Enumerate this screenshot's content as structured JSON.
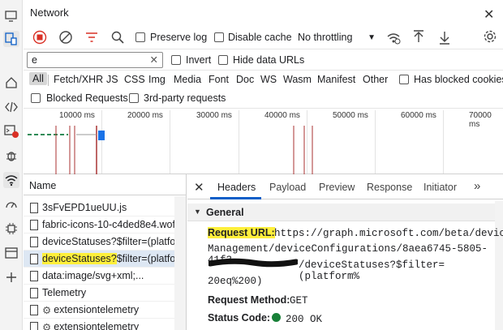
{
  "panel": {
    "title": "Network"
  },
  "toolbar": {
    "preserve_log": "Preserve log",
    "disable_cache": "Disable cache",
    "throttling": "No throttling"
  },
  "filter": {
    "value": "e",
    "invert": "Invert",
    "hide_data_urls": "Hide data URLs"
  },
  "types": [
    "All",
    "Fetch/XHR",
    "JS",
    "CSS",
    "Img",
    "Media",
    "Font",
    "Doc",
    "WS",
    "Wasm",
    "Manifest",
    "Other"
  ],
  "has_blocked_cookies": "Has blocked cookies",
  "blocked_requests": "Blocked Requests",
  "third_party": "3rd-party requests",
  "timeline": {
    "ticks": [
      "10000 ms",
      "20000 ms",
      "30000 ms",
      "40000 ms",
      "50000 ms",
      "60000 ms",
      "70000 ms"
    ]
  },
  "table": {
    "name_header": "Name",
    "rows": [
      {
        "name": "3sFvEPD1ueUU.js",
        "gear": false
      },
      {
        "name": "fabric-icons-10-c4ded8e4.wof",
        "gear": false
      },
      {
        "name": "deviceStatuses?$filter=(platfor",
        "gear": false
      },
      {
        "name_hl": "deviceStatuses?",
        "name_rest": "$filter=(platfor",
        "gear": false,
        "selected": true
      },
      {
        "name": "data:image/svg+xml;...",
        "gear": false
      },
      {
        "name": "Telemetry",
        "gear": false
      },
      {
        "name": "extensiontelemetry",
        "gear": true
      },
      {
        "name": "extensiontelemetry",
        "gear": true
      }
    ]
  },
  "details": {
    "tabs": [
      "Headers",
      "Payload",
      "Preview",
      "Response",
      "Initiator"
    ],
    "section": "General",
    "request_url_label": "Request URL:",
    "request_url_line1": "https://graph.microsoft.com/beta/device",
    "request_url_line2": "Management/deviceConfigurations/8aea6745-5805-41f3-",
    "request_url_line3": "/deviceStatuses?$filter=(platform%",
    "request_url_line4": "20eq%200)",
    "request_method_label": "Request Method:",
    "request_method": "GET",
    "status_code_label": "Status Code:",
    "status_code": "200 OK"
  },
  "colors": {
    "accent": "#0b5ec7",
    "record_red": "#d93025",
    "highlight": "#ffef3b",
    "status_green": "#188038"
  }
}
